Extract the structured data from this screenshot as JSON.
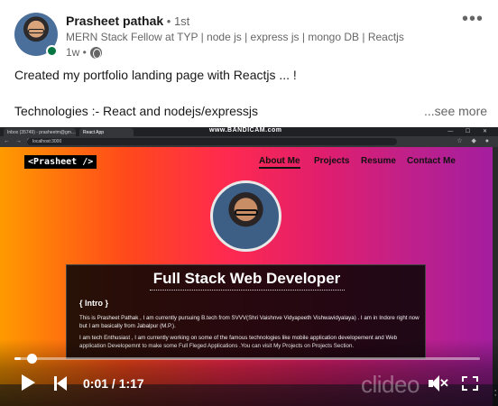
{
  "post": {
    "author_name": "Prasheet pathak",
    "degree": " • 1st",
    "headline": "MERN Stack Fellow at TYP | node js | express js | mongo DB | Reactjs",
    "age": "1w •",
    "more_label": "•••",
    "text_line1": "Created my portfolio landing page with Reactjs ... !",
    "text_line2": "Technologies :- React and nodejs/expressjs",
    "see_more": "...see more"
  },
  "video": {
    "watermark_top": "www.BANDICAM.com",
    "browser": {
      "tab1": "Inbox (35749) - prasheetm@gm…",
      "tab2": "React App",
      "address": "localhost:3000"
    },
    "site": {
      "logo": "<Prasheet />",
      "nav": [
        "About Me",
        "Projects",
        "Resume",
        "Contact Me"
      ],
      "active_nav": "About Me",
      "card_title": "Full Stack Web Developer",
      "intro_heading": "{ Intro }",
      "intro_p1": "This is Prasheet Pathak , I am currently pursuing B.tech from SVVV(Shri Vaishnve Vidyapeeth Vishwavidyalaya) . I am in Indore right now but I am basically from Jabalpur (M.P.).",
      "intro_p2": "I am tech Enthusiast , I am currently working on some of the famous technologies like mobile application developement and Web application Developemnt to make some Full Fleged Applications .You can visit My Projects on Projects Section."
    },
    "player": {
      "time": "0:01 / 1:17",
      "progress_fraction": 0.013,
      "brand_watermark": "clideo"
    },
    "icons": {
      "play": "play-icon",
      "back": "skip-back-icon",
      "volume": "volume-muted-icon",
      "fullscreen": "fullscreen-icon"
    }
  }
}
